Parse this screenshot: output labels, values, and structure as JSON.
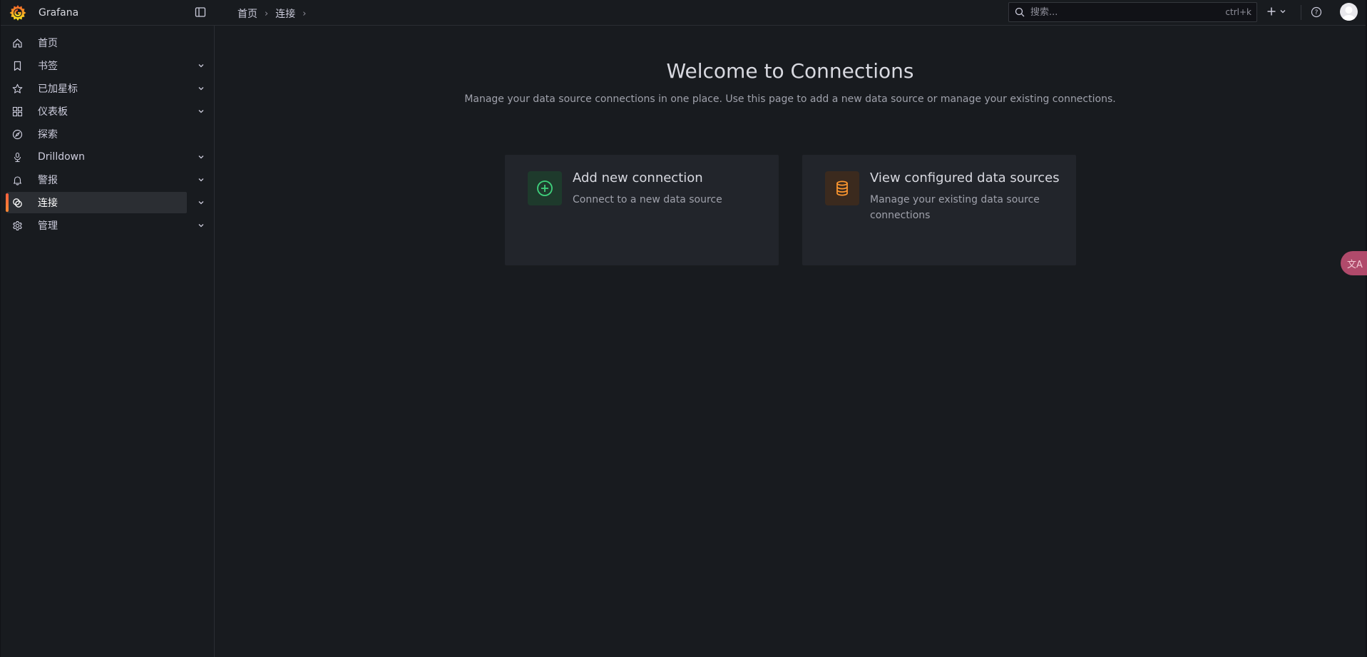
{
  "app": {
    "name": "Grafana"
  },
  "breadcrumb": [
    "首页",
    "连接"
  ],
  "search": {
    "placeholder": "搜索...",
    "shortcut": "ctrl+k"
  },
  "sidebar": {
    "items": [
      {
        "label": "首页",
        "icon": "home-icon",
        "expandable": false,
        "active": false
      },
      {
        "label": "书签",
        "icon": "bookmark-icon",
        "expandable": true,
        "active": false
      },
      {
        "label": "已加星标",
        "icon": "star-icon",
        "expandable": true,
        "active": false
      },
      {
        "label": "仪表板",
        "icon": "apps-icon",
        "expandable": true,
        "active": false
      },
      {
        "label": "探索",
        "icon": "compass-icon",
        "expandable": false,
        "active": false
      },
      {
        "label": "Drilldown",
        "icon": "drilldown-icon",
        "expandable": true,
        "active": false
      },
      {
        "label": "警报",
        "icon": "bell-icon",
        "expandable": true,
        "active": false
      },
      {
        "label": "连接",
        "icon": "connections-icon",
        "expandable": true,
        "active": true
      },
      {
        "label": "管理",
        "icon": "cog-icon",
        "expandable": true,
        "active": false
      }
    ]
  },
  "main": {
    "title": "Welcome to Connections",
    "subtitle": "Manage your data source connections in one place. Use this page to add a new data source or manage your existing connections.",
    "cards": [
      {
        "title": "Add new connection",
        "description": "Connect to a new data source",
        "icon": "plus-circle-icon",
        "icon_color": "#3fd17c"
      },
      {
        "title": "View configured data sources",
        "description": "Manage your existing data source connections",
        "icon": "database-icon",
        "icon_color": "#ff9830"
      }
    ]
  },
  "colors": {
    "accent": "#ff8833",
    "background": "#181b1f",
    "card": "#22252b"
  },
  "translate_button": {
    "label": "文A"
  }
}
